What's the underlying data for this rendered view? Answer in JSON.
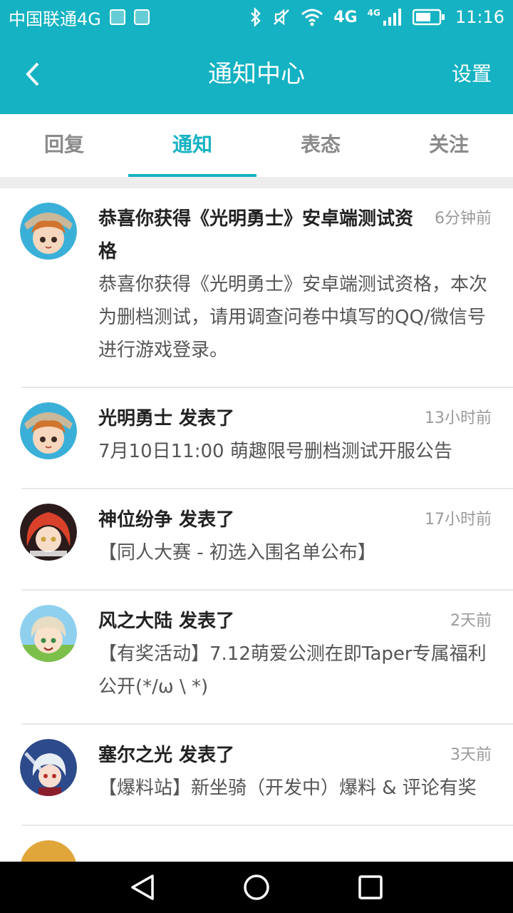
{
  "status_bar": {
    "carrier": "中国联通4G",
    "network": "4G",
    "network_small": "4G",
    "time": "11:16",
    "icons": [
      "image-icon",
      "app-icon",
      "bluetooth-icon",
      "mute-icon",
      "wifi-icon",
      "signal-icon",
      "battery-icon"
    ]
  },
  "app_bar": {
    "title": "通知中心",
    "settings_label": "设置",
    "back_icon": "back-arrow-icon"
  },
  "tabs": [
    {
      "label": "回复",
      "active": false
    },
    {
      "label": "通知",
      "active": true
    },
    {
      "label": "表态",
      "active": false
    },
    {
      "label": "关注",
      "active": false
    }
  ],
  "notifications": [
    {
      "avatar": "guangming-avatar",
      "title": "恭喜你获得《光明勇士》安卓端测试资格",
      "time": "6分钟前",
      "content": "恭喜你获得《光明勇士》安卓端测试资格，本次为删档测试，请用调查问卷中填写的QQ/微信号进行游戏登录。"
    },
    {
      "avatar": "guangming-avatar",
      "title": "光明勇士 发表了",
      "time": "13小时前",
      "content": "7月10日11:00 萌趣限号删档测试开服公告"
    },
    {
      "avatar": "shenwei-avatar",
      "title": "神位纷争 发表了",
      "time": "17小时前",
      "content": "【同人大赛 - 初选入围名单公布】"
    },
    {
      "avatar": "fengzhi-avatar",
      "title": "风之大陆 发表了",
      "time": "2天前",
      "content": "【有奖活动】7.12萌爱公测在即Taper专属福利公开(*/ω \\ *)"
    },
    {
      "avatar": "saier-avatar",
      "title": "塞尔之光 发表了",
      "time": "3天前",
      "content": "【爆料站】新坐骑（开发中）爆料 & 评论有奖"
    }
  ],
  "nav_bar": {
    "buttons": [
      "back-triangle-icon",
      "home-circle-icon",
      "recents-square-icon"
    ]
  },
  "colors": {
    "accent": "#14b2c2",
    "text_primary": "#222222",
    "text_secondary": "#555555",
    "text_muted": "#9a9a9a"
  }
}
